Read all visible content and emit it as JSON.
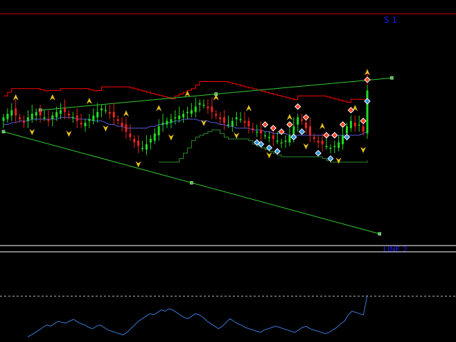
{
  "window": {
    "main_pane_level_label": "S 1",
    "lower_trendline_label": "LINE 2"
  },
  "colors": {
    "background": "#000000",
    "resistance_line": "#cc0000",
    "stop_line_upper": "#ff0000",
    "stop_line_lower": "#2e8b2e",
    "moving_average": "#5a5adc",
    "channel_line": "#33cc33",
    "bull_candle": "#22dd22",
    "bear_candle": "#ee2222",
    "fractal_arrow": "#e8c020",
    "signal_sell": "#ff4422",
    "signal_buy": "#3399dd",
    "oscillator": "#3a7ad9",
    "oscillator_level": "#bbbbbb",
    "pane_separator": "#ffffff",
    "level_label": "#1a1aff"
  },
  "icons": {
    "fractal": "triangle-arrow-icon",
    "sell_signal": "red-diamond-icon",
    "buy_signal": "blue-diamond-icon",
    "channel_anchor": "square-anchor-icon"
  },
  "chart_data": {
    "type": "candlestick",
    "price_pane": {
      "close": [
        60,
        62,
        64,
        61,
        59,
        57,
        60,
        62,
        63,
        61,
        60,
        58,
        61,
        63,
        64,
        63,
        61,
        60,
        58,
        56,
        57,
        59,
        61,
        63,
        65,
        64,
        62,
        60,
        58,
        55,
        52,
        49,
        46,
        44,
        43,
        45,
        48,
        51,
        55,
        57,
        58,
        59,
        60,
        61,
        62,
        63,
        64,
        66,
        68,
        67,
        65,
        63,
        61,
        59,
        57,
        56,
        58,
        60,
        59,
        57,
        55,
        53,
        52,
        51,
        50,
        49,
        48,
        47,
        46,
        47,
        50,
        55,
        60,
        58,
        54,
        50,
        48,
        46,
        45,
        44,
        43,
        44,
        46,
        50,
        55,
        58,
        55,
        56,
        52,
        75
      ],
      "ma": [
        56,
        56,
        57,
        57,
        58,
        58,
        58,
        59,
        59,
        59,
        59,
        59,
        59,
        59,
        60,
        60,
        60,
        60,
        59,
        59,
        59,
        59,
        58,
        58,
        58,
        57,
        56,
        56,
        55,
        55,
        54,
        54,
        54,
        54,
        54,
        54,
        55,
        55,
        56,
        56,
        57,
        57,
        58,
        58,
        59,
        59,
        59,
        59,
        58,
        58,
        58,
        57,
        57,
        56,
        56,
        55,
        55,
        54,
        54,
        54,
        54,
        53,
        53,
        53,
        52,
        52,
        51,
        51,
        51,
        51,
        50,
        50,
        50,
        50,
        50,
        50,
        50,
        50,
        50,
        50,
        50,
        50,
        50,
        50,
        50,
        50,
        50,
        50,
        51,
        52
      ],
      "fractals_up_idx": [
        3,
        12,
        21,
        30,
        38,
        45,
        52,
        60,
        70,
        78,
        86,
        89
      ],
      "fractals_down_idx": [
        7,
        16,
        25,
        33,
        41,
        49,
        57,
        65,
        74,
        82,
        88
      ],
      "sell_signals_idx": [
        64,
        66,
        68,
        70,
        72,
        74,
        79,
        81,
        83,
        85,
        88,
        89
      ],
      "buy_signals_idx": [
        62,
        63,
        65,
        67,
        71,
        73,
        77,
        80,
        84,
        89
      ],
      "channel_upper": {
        "from": [
          9,
          64
        ],
        "to": [
          95,
          82
        ]
      },
      "channel_lower": {
        "from": [
          0,
          52
        ],
        "to": [
          92,
          -5
        ]
      },
      "y_range": [
        -10,
        110
      ]
    },
    "oscillator_pane": {
      "values": [
        5,
        8,
        12,
        16,
        20,
        24,
        22,
        26,
        30,
        28,
        27,
        30,
        33,
        29,
        26,
        24,
        20,
        18,
        22,
        24,
        20,
        16,
        14,
        12,
        10,
        8,
        12,
        18,
        24,
        30,
        34,
        38,
        42,
        40,
        44,
        48,
        46,
        50,
        48,
        44,
        40,
        36,
        34,
        38,
        42,
        40,
        36,
        30,
        26,
        22,
        18,
        22,
        28,
        34,
        30,
        26,
        24,
        20,
        18,
        16,
        14,
        12,
        16,
        18,
        20,
        22,
        20,
        18,
        16,
        14,
        12,
        16,
        20,
        22,
        18,
        16,
        14,
        12,
        10,
        12,
        16,
        20,
        26,
        30,
        40,
        46,
        44,
        42,
        40,
        72
      ],
      "level": 70,
      "y_range": [
        0,
        100
      ]
    }
  }
}
